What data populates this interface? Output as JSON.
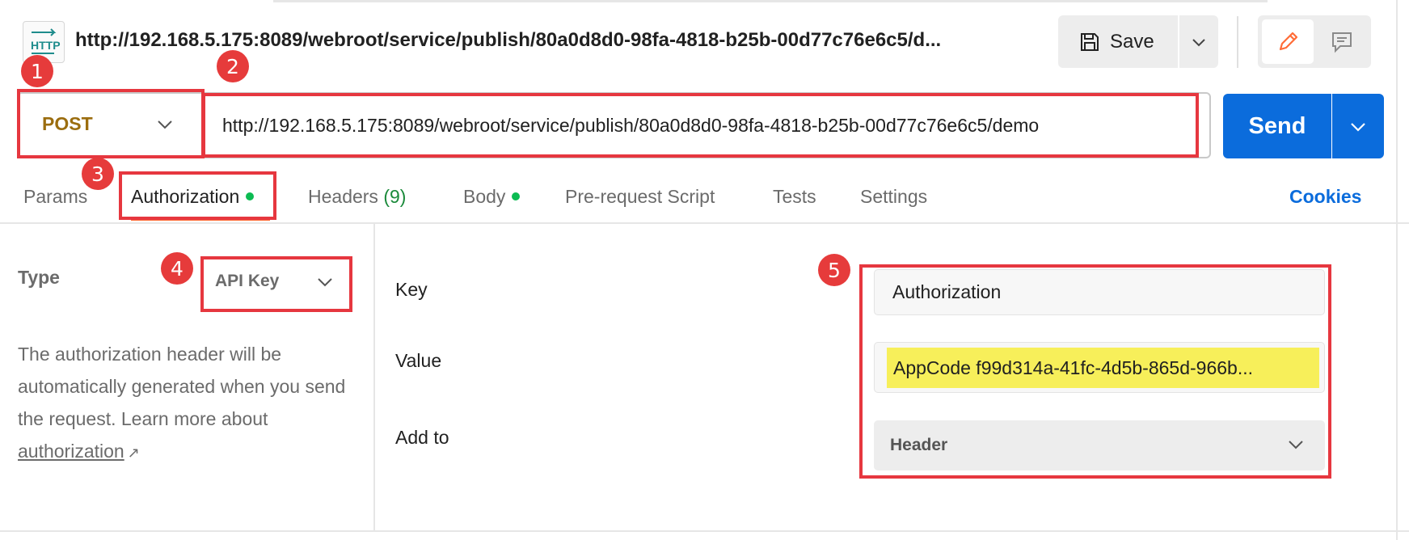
{
  "header": {
    "icon_text": "HTTP",
    "request_title": "http://192.168.5.175:8089/webroot/service/publish/80a0d8d0-98fa-4818-b25b-00d77c76e6c5/d...",
    "save_label": "Save"
  },
  "request": {
    "method": "POST",
    "url": "http://192.168.5.175:8089/webroot/service/publish/80a0d8d0-98fa-4818-b25b-00d77c76e6c5/demo",
    "send_label": "Send"
  },
  "tabs": {
    "params": "Params",
    "authorization": "Authorization",
    "headers": "Headers",
    "headers_count": "(9)",
    "body": "Body",
    "pre_request": "Pre-request Script",
    "tests": "Tests",
    "settings": "Settings",
    "cookies": "Cookies"
  },
  "auth": {
    "type_label": "Type",
    "type_value": "API Key",
    "description": "The authorization header will be automatically generated when you send the request. Learn more about ",
    "link_text": "authorization",
    "key_label": "Key",
    "key_value": "Authorization",
    "value_label": "Value",
    "value_value": "AppCode f99d314a-41fc-4d5b-865d-966b...",
    "addto_label": "Add to",
    "addto_value": "Header"
  },
  "annotations": [
    "1",
    "2",
    "3",
    "4",
    "5"
  ],
  "colors": {
    "accent_orange": "#ff6c37",
    "send_blue": "#0b6cdc",
    "method_color": "#9b6d0f",
    "annotation_red": "#e6373f",
    "highlight_yellow": "#f7ef5a",
    "dot_green": "#0cbb52"
  },
  "icons": [
    "http-icon",
    "save-icon",
    "chevron-down-icon",
    "pencil-icon",
    "comment-icon",
    "external-link-icon"
  ]
}
